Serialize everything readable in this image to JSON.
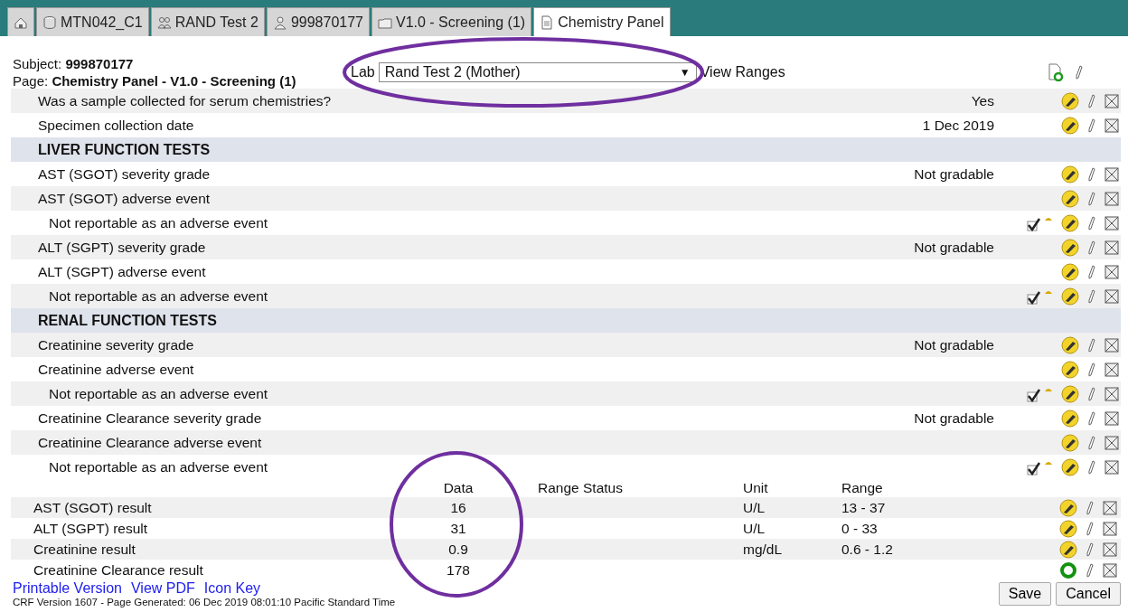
{
  "tabs": [
    {
      "kind": "home",
      "selected": false
    },
    {
      "kind": "study",
      "label": "MTN042_C1",
      "selected": false
    },
    {
      "kind": "site",
      "label": "RAND Test 2",
      "selected": false
    },
    {
      "kind": "subject",
      "label": "999870177",
      "selected": false
    },
    {
      "kind": "visit",
      "label": "V1.0 - Screening (1)",
      "selected": false
    },
    {
      "kind": "form",
      "label": "Chemistry Panel",
      "selected": true
    }
  ],
  "header": {
    "subject_label": "Subject:",
    "subject": "999870177",
    "page_label": "Page:",
    "page": "Chemistry Panel - V1.0 - Screening (1)",
    "lab_label": "Lab",
    "lab_value": "Rand Test 2 (Mother)",
    "lab_caret": "▼",
    "view_ranges": "View Ranges"
  },
  "rows": [
    {
      "kind": "item",
      "label": "Was a sample collected for serum chemistries?",
      "value": "Yes",
      "sub": false,
      "check": false
    },
    {
      "kind": "item",
      "label": "Specimen collection date",
      "value": "1 Dec 2019",
      "sub": false,
      "check": false
    },
    {
      "kind": "section",
      "label": "LIVER FUNCTION TESTS"
    },
    {
      "kind": "item",
      "label": "AST (SGOT) severity grade",
      "value": "Not gradable",
      "sub": false,
      "check": false
    },
    {
      "kind": "item",
      "label": "AST (SGOT) adverse event",
      "value": "",
      "sub": false,
      "check": false
    },
    {
      "kind": "item",
      "label": "Not reportable as an adverse event",
      "value": "",
      "sub": true,
      "check": true
    },
    {
      "kind": "item",
      "label": "ALT (SGPT) severity grade",
      "value": "Not gradable",
      "sub": false,
      "check": false
    },
    {
      "kind": "item",
      "label": "ALT (SGPT) adverse event",
      "value": "",
      "sub": false,
      "check": false
    },
    {
      "kind": "item",
      "label": "Not reportable as an adverse event",
      "value": "",
      "sub": true,
      "check": true
    },
    {
      "kind": "section",
      "label": "RENAL FUNCTION TESTS"
    },
    {
      "kind": "item",
      "label": "Creatinine severity grade",
      "value": "Not gradable",
      "sub": false,
      "check": false
    },
    {
      "kind": "item",
      "label": "Creatinine adverse event",
      "value": "",
      "sub": false,
      "check": false
    },
    {
      "kind": "item",
      "label": "Not reportable as an adverse event",
      "value": "",
      "sub": true,
      "check": true
    },
    {
      "kind": "item",
      "label": "Creatinine Clearance severity grade",
      "value": "Not gradable",
      "sub": false,
      "check": false
    },
    {
      "kind": "item",
      "label": "Creatinine Clearance adverse event",
      "value": "",
      "sub": false,
      "check": false
    },
    {
      "kind": "item",
      "label": "Not reportable as an adverse event",
      "value": "",
      "sub": true,
      "check": true
    }
  ],
  "results": {
    "columns": [
      "Data",
      "Range Status",
      "Unit",
      "Range"
    ],
    "rows": [
      {
        "label": "AST (SGOT) result",
        "data": "16",
        "range_status": "",
        "unit": "U/L",
        "range": "13 - 37",
        "kind": "edit"
      },
      {
        "label": "ALT (SGPT) result",
        "data": "31",
        "range_status": "",
        "unit": "U/L",
        "range": "0 - 33",
        "kind": "edit"
      },
      {
        "label": "Creatinine result",
        "data": "0.9",
        "range_status": "",
        "unit": "mg/dL",
        "range": "0.6 - 1.2",
        "kind": "edit"
      },
      {
        "label": "Creatinine Clearance result",
        "data": "178",
        "range_status": "",
        "unit": "",
        "range": "",
        "kind": "complete"
      }
    ]
  },
  "footer": {
    "links": [
      "Printable Version",
      "View PDF",
      "Icon Key"
    ],
    "version": "CRF Version 1607 - Page Generated: 06 Dec 2019 08:01:10 Pacific Standard Time",
    "buttons": [
      "Save",
      "Cancel"
    ]
  }
}
